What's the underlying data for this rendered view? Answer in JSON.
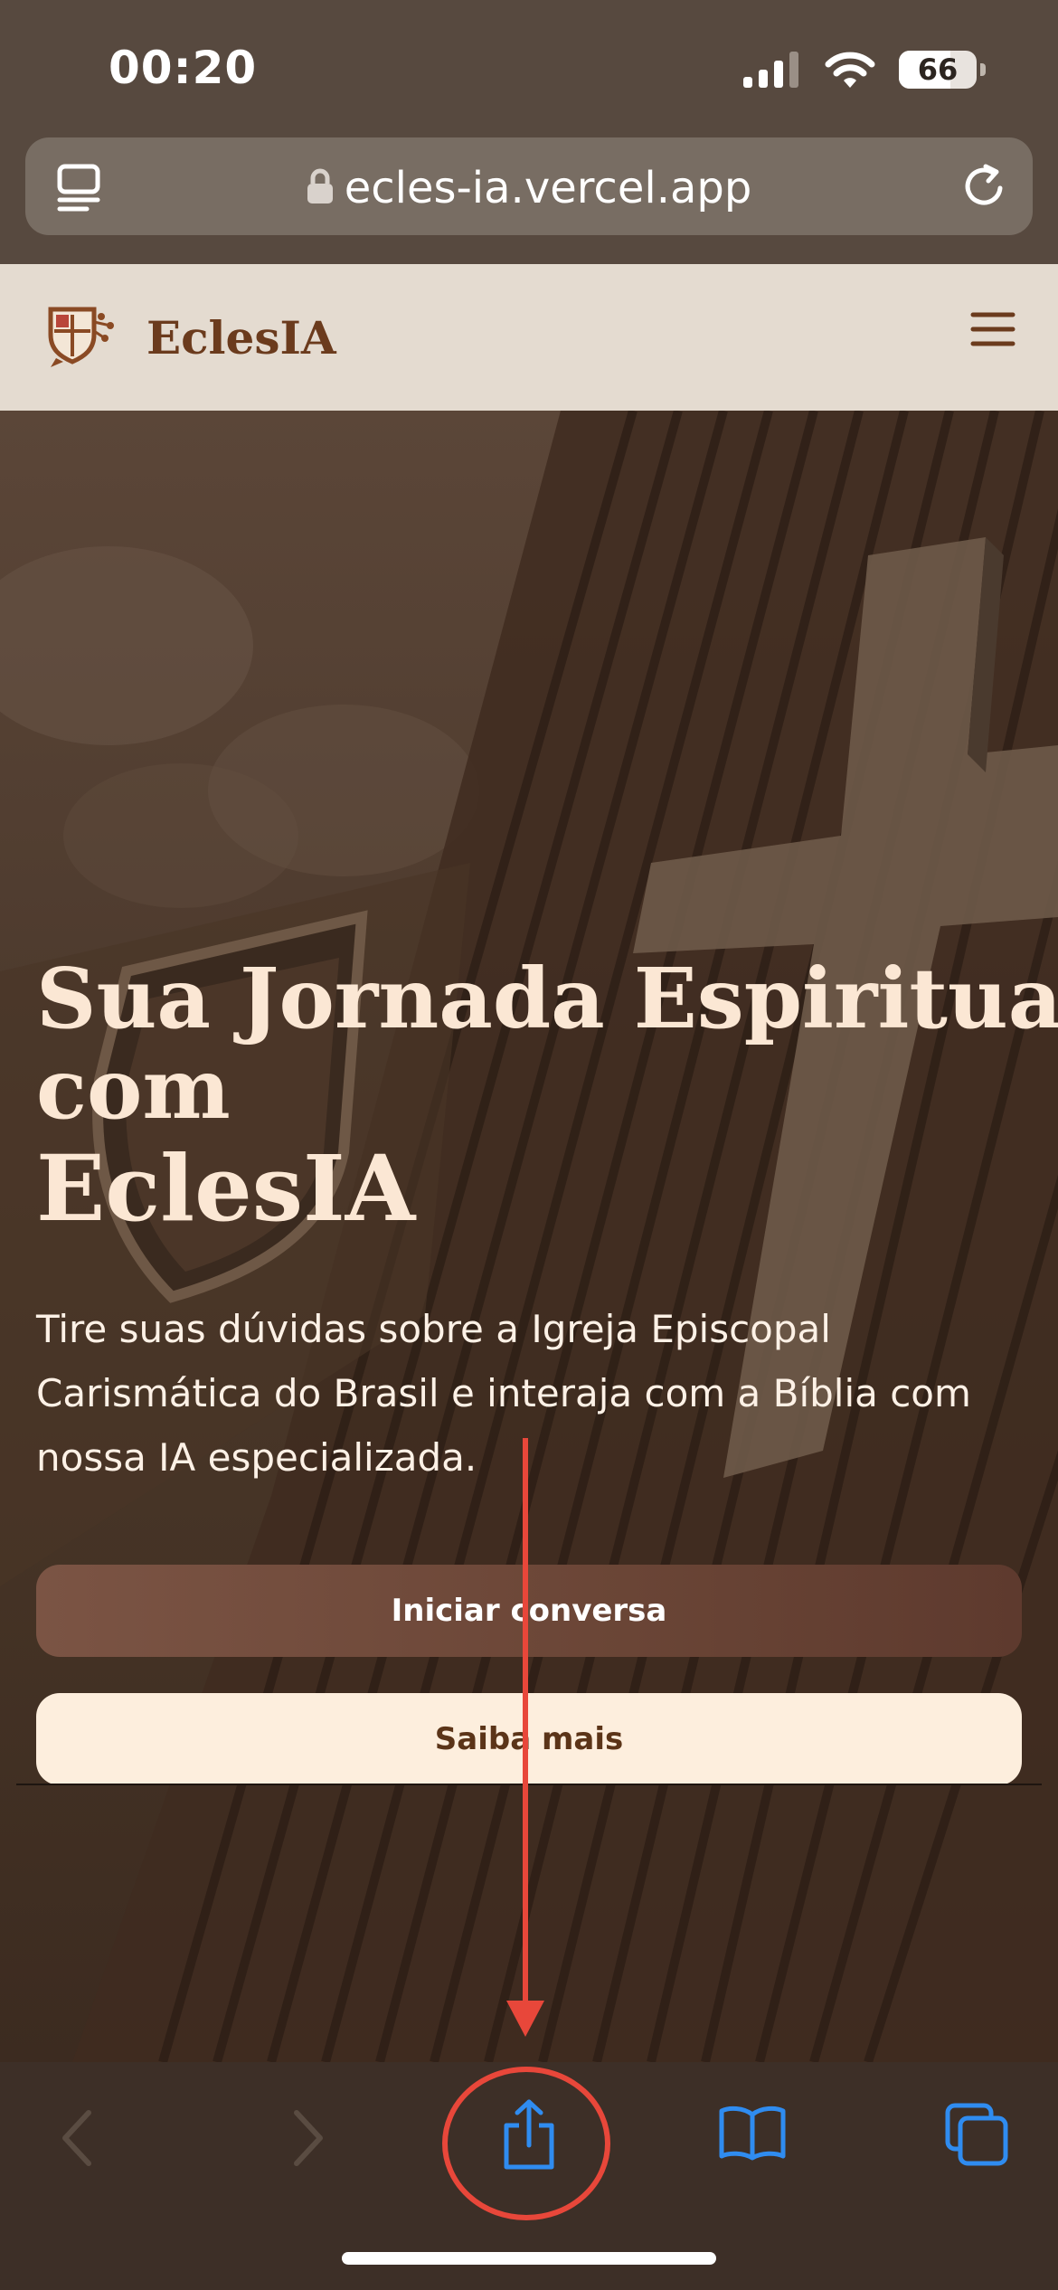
{
  "status_bar": {
    "time": "00:20",
    "battery": "66",
    "battery_percent": 66
  },
  "browser": {
    "url": "ecles-ia.vercel.app"
  },
  "site": {
    "brand": "EclesIA"
  },
  "hero": {
    "title_line1": "Sua Jornada Espiritual",
    "title_line2": "com",
    "title_line3": "EclesIA",
    "description": "Tire suas dúvidas sobre a Igreja Episcopal Carismática do Brasil e interaja com a Bíblia com nossa IA especializada.",
    "primary_button": "Iniciar conversa",
    "secondary_button": "Saiba mais"
  },
  "toolbar": {
    "items": [
      "back-icon",
      "forward-icon",
      "share-icon",
      "bookmarks-icon",
      "tabs-icon"
    ]
  },
  "colors": {
    "accent_blue": "#2f8cf0",
    "annotation_red": "#e8473a",
    "brand_brown": "#6b3b1d",
    "hero_text": "#fbe7d4"
  }
}
